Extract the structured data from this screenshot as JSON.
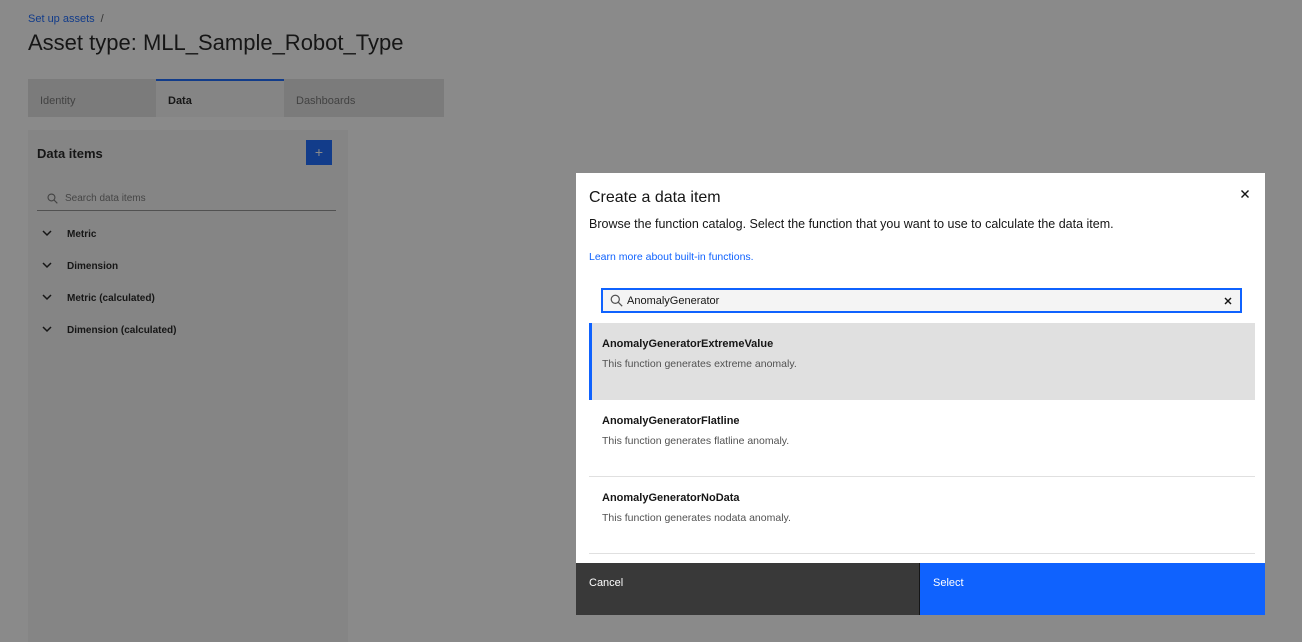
{
  "page": {
    "breadcrumb": {
      "link": "Set up assets",
      "separator": "/"
    },
    "title": "Asset type: MLL_Sample_Robot_Type",
    "tabs": [
      {
        "label": "Identity"
      },
      {
        "label": "Data",
        "active": true
      },
      {
        "label": "Dashboards"
      }
    ]
  },
  "data_panel": {
    "title": "Data items",
    "add_button": "+",
    "search_placeholder": "Search data items",
    "groups": [
      {
        "label": "Metric"
      },
      {
        "label": "Dimension"
      },
      {
        "label": "Metric (calculated)"
      },
      {
        "label": "Dimension (calculated)"
      }
    ]
  },
  "modal": {
    "title": "Create a data item",
    "description": "Browse the function catalog. Select the function that you want to use to calculate the data item.",
    "link": "Learn more about built-in functions.",
    "search_value": "AnomalyGenerator",
    "results": [
      {
        "name": "AnomalyGeneratorExtremeValue",
        "description": "This function generates extreme anomaly.",
        "selected": true
      },
      {
        "name": "AnomalyGeneratorFlatline",
        "description": "This function generates flatline anomaly.",
        "selected": false
      },
      {
        "name": "AnomalyGeneratorNoData",
        "description": "This function generates nodata anomaly.",
        "selected": false
      }
    ],
    "cancel_label": "Cancel",
    "select_label": "Select"
  },
  "colors": {
    "primary": "#0f62fe",
    "overlay": "rgba(22,22,22,0.5)",
    "cancel_bg": "#393939",
    "selected_row": "#e0e0e0"
  },
  "icons": {
    "search": "search-icon",
    "close": "close-icon",
    "clear": "clear-icon",
    "chevron": "chevron-down-icon"
  }
}
